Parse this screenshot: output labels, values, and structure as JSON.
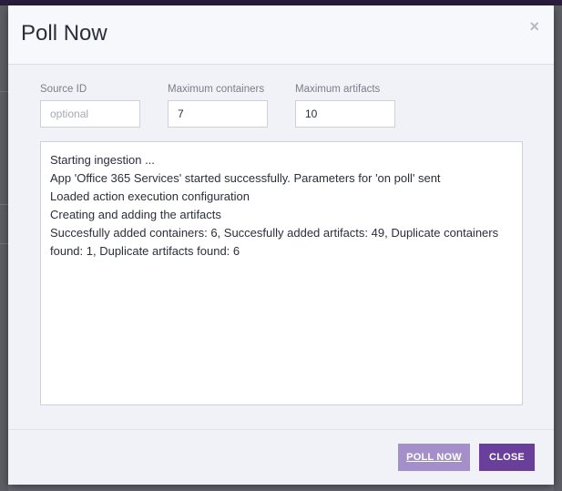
{
  "dialog": {
    "title": "Poll Now",
    "close_symbol": "×"
  },
  "fields": {
    "source_id": {
      "label": "Source ID",
      "value": "",
      "placeholder": "optional"
    },
    "max_containers": {
      "label": "Maximum containers",
      "value": "7",
      "placeholder": ""
    },
    "max_artifacts": {
      "label": "Maximum artifacts",
      "value": "10",
      "placeholder": ""
    }
  },
  "log": {
    "lines": [
      "Starting ingestion ...",
      "App 'Office 365 Services' started successfully. Parameters for 'on poll' sent",
      "Loaded action execution configuration",
      "Creating and adding the artifacts",
      "Succesfully added containers: 6, Succesfully added artifacts: 49, Duplicate containers found: 1, Duplicate artifacts found: 6"
    ]
  },
  "buttons": {
    "poll_now": "POLL NOW",
    "close": "CLOSE"
  },
  "colors": {
    "primary_button": "#6a3f9b",
    "secondary_button": "#a48fcb",
    "top_bar": "#2b1d3d"
  }
}
